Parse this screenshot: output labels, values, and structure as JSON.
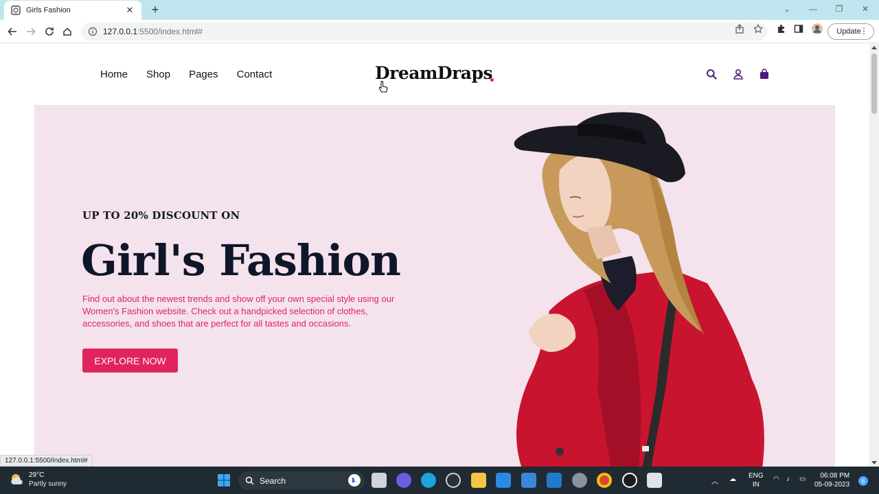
{
  "browser": {
    "tab_title": "Girls Fashion",
    "url_host": "127.0.0.1",
    "url_rest": ":5500/index.html#",
    "update_label": "Update",
    "status_url": "127.0.0.1:5500/index.html#"
  },
  "site": {
    "nav": [
      "Home",
      "Shop",
      "Pages",
      "Contact"
    ],
    "logo": "DreamDraps",
    "hero": {
      "eyebrow": "UP TO 20% DISCOUNT ON",
      "headline": "Girl's Fashion",
      "description": "Find out about the newest trends and show off your own special style using our Women's Fashion website. Check out a handpicked selection of clothes, accessories, and shoes that are perfect for all tastes and occasions.",
      "cta": "EXPLORE NOW"
    },
    "colors": {
      "accent": "#e0245e",
      "hero_bg": "#f4e2ec",
      "icon": "#4b1a7a"
    },
    "icons": [
      "search-icon",
      "user-icon",
      "bag-icon"
    ]
  },
  "taskbar": {
    "weather_temp": "29°C",
    "weather_cond": "Partly sunny",
    "search_label": "Search",
    "lang_top": "ENG",
    "lang_bottom": "IN",
    "time": "06:08 PM",
    "date": "05-09-2023",
    "notif_count": "6"
  }
}
